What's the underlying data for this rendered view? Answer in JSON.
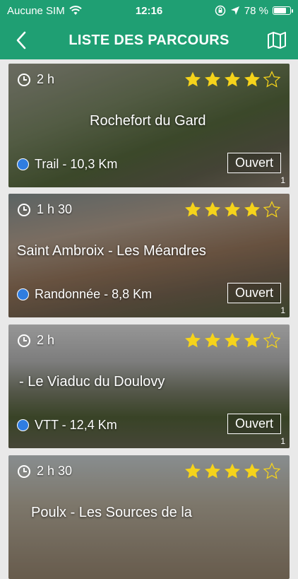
{
  "status_bar": {
    "carrier": "Aucune SIM",
    "time": "12:16",
    "battery": "78 %",
    "battery_level": 0.78
  },
  "header": {
    "title": "LISTE DES PARCOURS",
    "back_icon": "chevron-left-icon",
    "map_icon": "map-icon"
  },
  "colors": {
    "header_bg": "#1f9f73",
    "star": "#f5d31b",
    "activity_dot": "#2f7de1"
  },
  "routes": [
    {
      "duration": "2 h",
      "rating": 4,
      "rating_max": 5,
      "title": "Rochefort du Gard",
      "activity": "Trail - 10,3 Km",
      "status": "Ouvert",
      "count": "1"
    },
    {
      "duration": "1 h 30",
      "rating": 4,
      "rating_max": 5,
      "title": "Saint Ambroix - Les Méandres",
      "activity": "Randonnée - 8,8 Km",
      "status": "Ouvert",
      "count": "1"
    },
    {
      "duration": "2 h",
      "rating": 4,
      "rating_max": 5,
      "title": "- Le Viaduc du Doulovy",
      "activity": "VTT - 12,4 Km",
      "status": "Ouvert",
      "count": "1"
    },
    {
      "duration": "2 h 30",
      "rating": 4,
      "rating_max": 5,
      "title": "Poulx - Les Sources de la",
      "activity": "",
      "status": "",
      "count": ""
    }
  ]
}
